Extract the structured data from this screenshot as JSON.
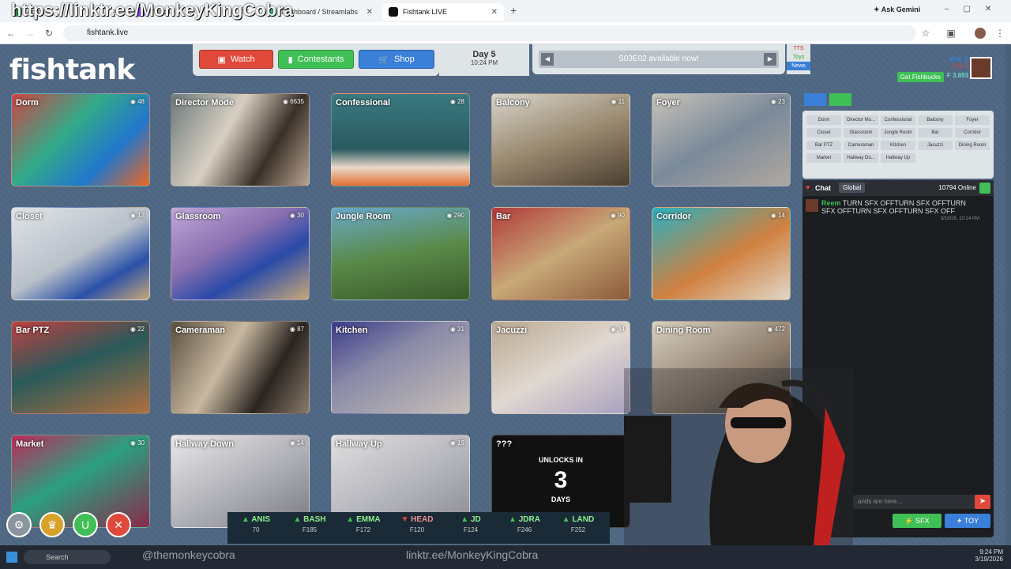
{
  "browser": {
    "tabs": [
      {
        "label": "Admin",
        "fav": "#2a8c4a"
      },
      {
        "label": "Twitch",
        "fav": "#9146ff"
      },
      {
        "label": "Dashboard / Streamlabs",
        "fav": "#31c3a2"
      },
      {
        "label": "Fishtank LIVE",
        "fav": "#111"
      }
    ],
    "url": "fishtank.live",
    "ask_gemini": "Ask Gemini",
    "overlay_url": "https://linktr.ee/MonkeyKingCobra"
  },
  "site": {
    "logo": "fishtank",
    "nav": {
      "watch": "Watch",
      "contestants": "Contestants",
      "shop": "Shop"
    },
    "day": {
      "label": "Day 5",
      "time": "10:24 PM"
    },
    "announcement": "S03E02 available now!",
    "tts": [
      "TTS",
      "Toys",
      "News"
    ],
    "user": {
      "name": "alex_b",
      "level": "LVL 2",
      "get_fishbucks": "Get Fishbucks",
      "balance": "3,893"
    },
    "cameras": [
      {
        "name": "Dorm",
        "count": "48",
        "bg": "linear-gradient(135deg,#c44,#3a8 40%,#27c 70%,#e62)"
      },
      {
        "name": "Director Mode",
        "count": "6635",
        "bg": "linear-gradient(120deg,#6b7a7a,#d8cfc2 40%,#3b3028 70%,#b7a491)"
      },
      {
        "name": "Confessional",
        "count": "28",
        "bg": "linear-gradient(180deg,#3a7a80,#2a5a60 60%,#e8d8c8 80%,#e07030)"
      },
      {
        "name": "Balcony",
        "count": "11",
        "bg": "linear-gradient(160deg,#d8d4cc,#9a8a70 50%,#4a3e30)"
      },
      {
        "name": "Foyer",
        "count": "23",
        "bg": "linear-gradient(150deg,#c8c2b8,#7a8a9a 50%,#b0a8a0)"
      },
      {
        "name": "Closet",
        "count": "12",
        "bg": "linear-gradient(150deg,#e0e4e8,#b8c0c8 50%,#2a50a8 75%,#c8a878)"
      },
      {
        "name": "Glassroom",
        "count": "30",
        "bg": "linear-gradient(150deg,#c0a8d8,#8a70b0 40%,#2a4aa8 65%,#c8a878)"
      },
      {
        "name": "Jungle Room",
        "count": "290",
        "bg": "linear-gradient(170deg,#6aa8c8,#5a8a4a 50%,#3a5a2a)"
      },
      {
        "name": "Bar",
        "count": "90",
        "bg": "linear-gradient(150deg,#b03a3a,#c8a878 50%,#8a5a3a)"
      },
      {
        "name": "Corridor",
        "count": "14",
        "bg": "linear-gradient(150deg,#2ab0c0,#d08040 55%,#e0d8c8)"
      },
      {
        "name": "Bar PTZ",
        "count": "22",
        "bg": "linear-gradient(160deg,#c04040,#2a5a5a 45%,#b07040)"
      },
      {
        "name": "Cameraman",
        "count": "87",
        "bg": "linear-gradient(120deg,#5a5040,#c8b8a0 40%,#2a2420 70%,#8a7a6a)"
      },
      {
        "name": "Kitchen",
        "count": "31",
        "bg": "linear-gradient(150deg,#3a3a8a,#8a8aa8 40%,#c8c0b8)"
      },
      {
        "name": "Jacuzzi",
        "count": "34",
        "bg": "linear-gradient(150deg,#b8a890,#e0d8d0 50%,#a8a0c0)"
      },
      {
        "name": "Dining Room",
        "count": "472",
        "bg": "linear-gradient(150deg,#d8d0c0,#8a7a6a 60%,#3a3a3a)"
      },
      {
        "name": "Market",
        "count": "30",
        "bg": "linear-gradient(150deg,#c02a5a,#2aa080 45%,#8a2a4a)"
      },
      {
        "name": "Hallway Down",
        "count": "14",
        "bg": "linear-gradient(150deg,#e8e8e8,#a8a8b0 60%,#7a7a80)"
      },
      {
        "name": "Hallway Up",
        "count": "19",
        "bg": "linear-gradient(150deg,#e0e0e0,#b0b0b8 60%,#8a8a90)"
      }
    ],
    "locked": {
      "name": "???",
      "unlocks": "UNLOCKS IN",
      "days": "3",
      "days_label": "DAYS"
    },
    "room_select": [
      "Dorm",
      "Director Mo...",
      "Confessional",
      "Balcony",
      "Foyer",
      "Closet",
      "Glassroom",
      "Jungle Room",
      "Bar",
      "Corridor",
      "Bar PTZ",
      "Cameraman",
      "Kitchen",
      "Jacuzzi",
      "Dining Room",
      "Market",
      "Hallway Do...",
      "Hallway Up"
    ],
    "chat": {
      "title": "Chat",
      "tab": "Global",
      "online": "10794 Online",
      "message": {
        "user": "Reem",
        "text": "TURN SFX OFFTURN SFX OFFTURN SFX OFFTURN SFX OFFTURN SFX OFF",
        "time": "3/19/26, 10:24 PM"
      },
      "input_placeholder": "ands are here...",
      "sfx": "SFX",
      "toy": "TOY"
    },
    "ticker": [
      {
        "name": "ANIS",
        "price": "70",
        "up": true
      },
      {
        "name": "BASH",
        "price": "F185",
        "up": true
      },
      {
        "name": "EMMA",
        "price": "F172",
        "up": true
      },
      {
        "name": "HEAD",
        "price": "F120",
        "up": false
      },
      {
        "name": "JD",
        "price": "F124",
        "up": true
      },
      {
        "name": "JDRA",
        "price": "F246",
        "up": true
      },
      {
        "name": "LAND",
        "price": "F252",
        "up": true
      }
    ]
  },
  "overlay": {
    "watermark": "linktr.ee/MonkeyKingCobra",
    "ig": "@themonkeycobra",
    "clock": "9:24 PM",
    "date": "3/19/2026",
    "search": "Search"
  }
}
